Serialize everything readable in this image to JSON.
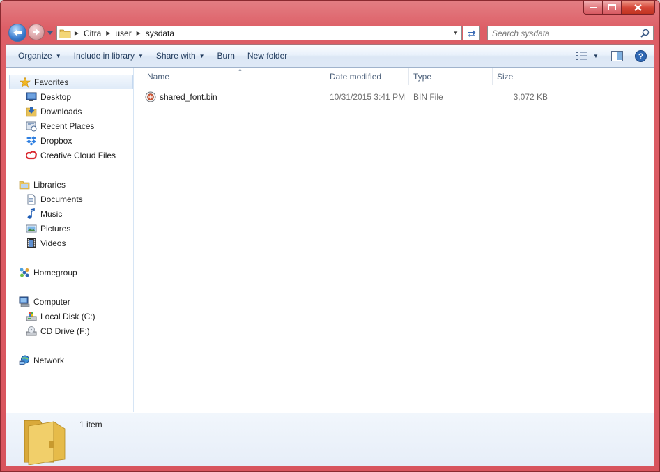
{
  "window": {
    "caption": {
      "minimize_glyph": "–",
      "maximize_glyph": "□",
      "close_glyph": "✕"
    },
    "accent_color": "#d8545d"
  },
  "navigation": {
    "breadcrumb": [
      "Citra",
      "user",
      "sysdata"
    ],
    "search_placeholder": "Search sysdata"
  },
  "toolbar": {
    "organize": "Organize",
    "include_in_library": "Include in library",
    "share_with": "Share with",
    "burn": "Burn",
    "new_folder": "New folder"
  },
  "sidebar": {
    "favorites": {
      "label": "Favorites",
      "items": [
        {
          "label": "Desktop",
          "icon": "desktop-icon"
        },
        {
          "label": "Downloads",
          "icon": "downloads-icon"
        },
        {
          "label": "Recent Places",
          "icon": "recent-places-icon"
        },
        {
          "label": "Dropbox",
          "icon": "dropbox-icon"
        },
        {
          "label": "Creative Cloud Files",
          "icon": "creative-cloud-icon"
        }
      ]
    },
    "libraries": {
      "label": "Libraries",
      "items": [
        {
          "label": "Documents",
          "icon": "documents-icon"
        },
        {
          "label": "Music",
          "icon": "music-icon"
        },
        {
          "label": "Pictures",
          "icon": "pictures-icon"
        },
        {
          "label": "Videos",
          "icon": "videos-icon"
        }
      ]
    },
    "homegroup": {
      "label": "Homegroup"
    },
    "computer": {
      "label": "Computer",
      "items": [
        {
          "label": "Local Disk (C:)",
          "icon": "local-disk-icon"
        },
        {
          "label": "CD Drive (F:)",
          "icon": "cd-drive-icon"
        }
      ]
    },
    "network": {
      "label": "Network"
    }
  },
  "file_list": {
    "columns": [
      "Name",
      "Date modified",
      "Type",
      "Size"
    ],
    "rows": [
      {
        "name": "shared_font.bin",
        "date_modified": "10/31/2015 3:41 PM",
        "type": "BIN File",
        "size": "3,072 KB",
        "icon": "bin-file-icon"
      }
    ]
  },
  "details": {
    "item_count": "1 item"
  }
}
